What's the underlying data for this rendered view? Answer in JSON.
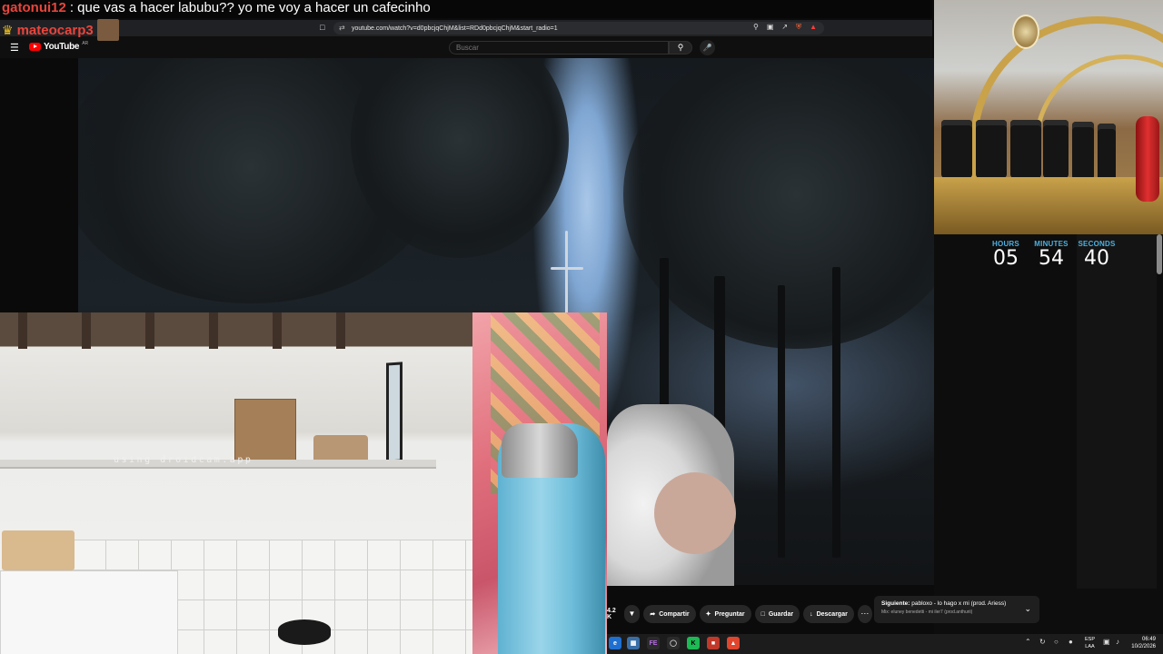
{
  "chat": {
    "line1_user": "gatonui12",
    "line1_message": ": que vas a hacer labubu?? yo me voy a hacer un cafecinho",
    "line2_user": "mateocarp3"
  },
  "browser": {
    "url": "youtube.com/watch?v=d0pbcjqChjM&list=RDd0pbcjqChjM&start_radio=1"
  },
  "youtube": {
    "logo_text": "YouTube",
    "region": "AR",
    "search_placeholder": "Buscar",
    "like_count": "4.2 K",
    "actions": {
      "share": "Compartir",
      "ask": "Preguntar",
      "save": "Guardar",
      "download": "Descargar"
    },
    "next": {
      "label": "Siguiente:",
      "title": "pabloxo - lo hago x mi (prod. Ariess)",
      "subtitle": "Mix: eluney benedetti - mi iler7 (prod.anthurii)"
    }
  },
  "webcam": {
    "watermark": "using droidcam.app"
  },
  "timer": {
    "hours_label": "HOURS",
    "hours": "05",
    "minutes_label": "MINUTES",
    "minutes": "54",
    "seconds_label": "SECONDS",
    "seconds": "40"
  },
  "taskbar": {
    "lang_top": "ESP",
    "lang_bottom": "LAA",
    "time": "06:49",
    "date": "10/2/2026"
  },
  "colors": {
    "timer_label": "#4fb0e0",
    "chat_user": "#e8453c",
    "yt_red": "#ff0000"
  }
}
